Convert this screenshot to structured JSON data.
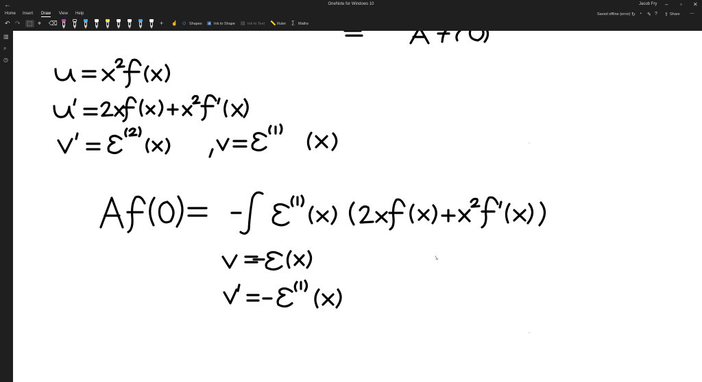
{
  "window": {
    "title": "OneNote for Windows 10",
    "user": "Jacob Fry",
    "status": "Saved offline (error)",
    "share_label": "Share"
  },
  "menu": {
    "tabs": [
      "Home",
      "Insert",
      "Draw",
      "View",
      "Help"
    ],
    "active_tab": "Draw"
  },
  "toolbar": {
    "shapes_label": "Shapes",
    "ink_to_shape_label": "Ink to Shape",
    "ink_to_text_label": "Ink to Text",
    "ruler_label": "Ruler",
    "maths_label": "Maths",
    "pen_colors": [
      "#c040c0",
      "#000000",
      "#ffffff",
      "#3fa9f5",
      "#ffffff",
      "#f5e05a",
      "#ffffff",
      "#ffffff",
      "#ffffff",
      "#3fa9f5",
      "#ffffff"
    ]
  },
  "icons": {
    "back": "back-arrow-icon",
    "undo": "undo-icon",
    "redo": "redo-icon",
    "lasso": "lasso-select-icon",
    "add_space": "add-space-icon",
    "eraser": "eraser-icon",
    "add_pen": "add-pen-icon",
    "search": "search-icon",
    "recent": "recent-icon",
    "notebooks": "notebooks-icon"
  }
}
